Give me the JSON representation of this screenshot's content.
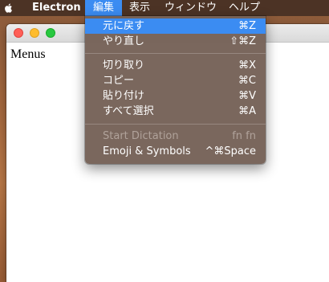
{
  "menubar": {
    "apple_icon": "apple-logo-icon",
    "app_name": "Electron",
    "menus": [
      "編集",
      "表示",
      "ウィンドウ",
      "ヘルプ"
    ],
    "active_menu": "編集"
  },
  "window": {
    "content_text": "Menus",
    "controls": [
      "close",
      "minimize",
      "zoom"
    ]
  },
  "edit_menu": {
    "groups": [
      [
        {
          "label": "元に戻す",
          "shortcut": "⌘Z"
        },
        {
          "label": "やり直し",
          "shortcut": "⇧⌘Z"
        }
      ],
      [
        {
          "label": "切り取り",
          "shortcut": "⌘X"
        },
        {
          "label": "コピー",
          "shortcut": "⌘C"
        },
        {
          "label": "貼り付け",
          "shortcut": "⌘V"
        },
        {
          "label": "すべて選択",
          "shortcut": "⌘A"
        }
      ],
      [
        {
          "label": "Start Dictation",
          "shortcut": "fn fn",
          "disabled": true
        },
        {
          "label": "Emoji & Symbols",
          "shortcut": "^⌘Space"
        }
      ]
    ],
    "highlighted": "元に戻す"
  },
  "colors": {
    "highlight": "#3b8cf2",
    "menu_bg": "#766258",
    "menubar_bg": "#463024"
  }
}
